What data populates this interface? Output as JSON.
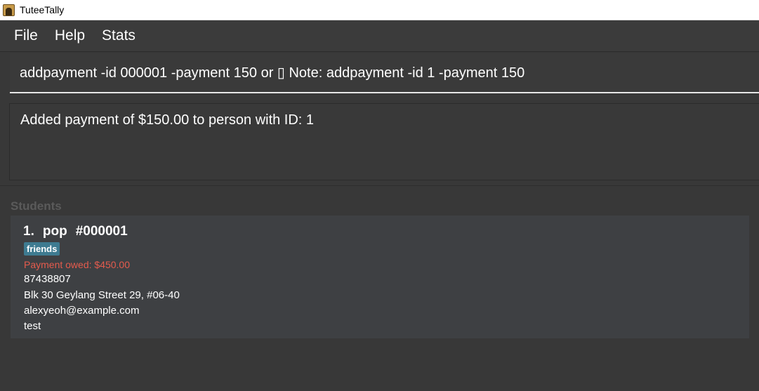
{
  "window": {
    "title": "TuteeTally",
    "icon": "app-user-icon"
  },
  "menu": {
    "items": [
      "File",
      "Help",
      "Stats"
    ]
  },
  "command": {
    "placeholder": "addpayment -id 000001 -payment 150 or ▯ Note: addpayment -id 1 -payment 150",
    "value": ""
  },
  "result": {
    "message": "Added payment of $150.00 to person with ID: 1"
  },
  "students": {
    "title": "Students",
    "cards": [
      {
        "index": "1.",
        "name": "pop",
        "id": "#000001",
        "tags": [
          "friends"
        ],
        "payment_owed": "Payment owed: $450.00",
        "phone": "87438807",
        "address": "Blk 30 Geylang Street 29, #06-40",
        "email": "alexyeoh@example.com",
        "subject": "test"
      }
    ]
  },
  "colors": {
    "background": "#383838",
    "card": "#3e4043",
    "tag": "#3e7b91",
    "owed": "#e55b4d",
    "list_title": "#5a5a5a"
  }
}
